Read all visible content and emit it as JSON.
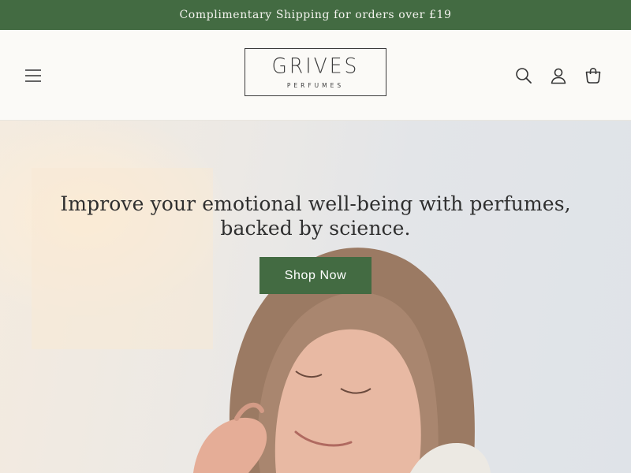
{
  "announcement": {
    "text": "Complimentary Shipping for orders over £19"
  },
  "header": {
    "logo": {
      "name": "GRIVES",
      "subtitle": "PERFUMES"
    },
    "icons": [
      "menu-icon",
      "search-icon",
      "account-icon",
      "cart-icon"
    ]
  },
  "hero": {
    "heading_line1": "Improve your emotional well-being with perfumes,",
    "heading_line2": "backed by science.",
    "cta_label": "Shop Now"
  },
  "colors": {
    "brand_green": "#436b42",
    "background": "#fbfaf7",
    "text": "#2f2f2f"
  }
}
